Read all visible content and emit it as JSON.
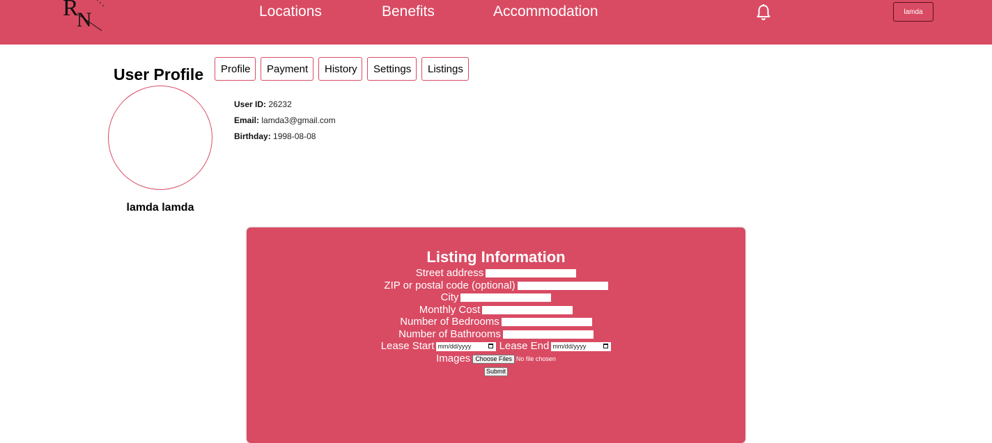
{
  "header": {
    "logo_text": "RN",
    "nav": [
      {
        "label": "Locations"
      },
      {
        "label": "Benefits"
      },
      {
        "label": "Accommodation"
      }
    ],
    "user_button": "lamda",
    "brand_color": "#d94b63"
  },
  "profile": {
    "title": "User Profile",
    "tabs": [
      {
        "label": "Profile"
      },
      {
        "label": "Payment"
      },
      {
        "label": "History"
      },
      {
        "label": "Settings"
      },
      {
        "label": "Listings"
      }
    ],
    "display_name": "lamda lamda",
    "fields": [
      {
        "label": "User ID",
        "value": "26232"
      },
      {
        "label": "Email",
        "value": "lamda3@gmail.com"
      },
      {
        "label": "Birthday",
        "value": "1998-08-08"
      }
    ]
  },
  "listing_form": {
    "title": "Listing Information",
    "street_label": "Street address",
    "zip_label": "ZIP or postal code (optional)",
    "city_label": "City",
    "cost_label": "Monthly Cost",
    "bedrooms_label": "Number of Bedrooms",
    "bathrooms_label": "Number of Bathrooms",
    "lease_start_label": "Lease Start",
    "lease_end_label": "Lease End",
    "date_placeholder": "mm/dd/yyyy",
    "images_label": "Images",
    "choose_files": "Choose Files",
    "file_status": "No file chosen",
    "submit": "Submit"
  }
}
